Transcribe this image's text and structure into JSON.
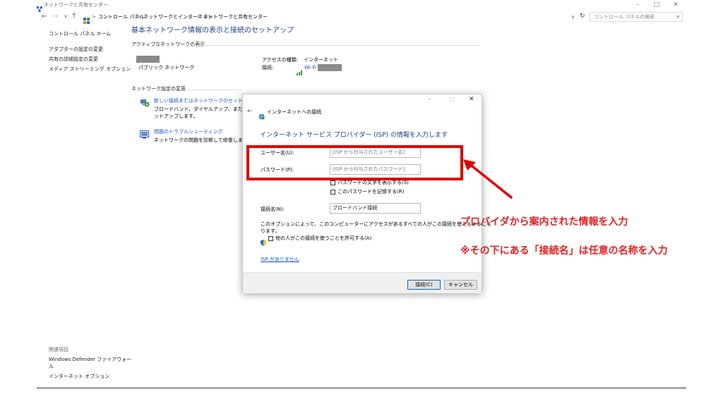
{
  "window": {
    "title": "ネットワークと共有センター",
    "controls": [
      "–",
      "□",
      "✕"
    ]
  },
  "address": {
    "breadcrumb": [
      "コントロール パネル",
      "ネットワークとインターネット",
      "ネットワークと共有センター"
    ],
    "separator": ">",
    "search_placeholder": "コントロール パネルの検索"
  },
  "sidebar": {
    "home": "コントロール パネル ホーム",
    "items": [
      "アダプターの設定の変更",
      "共有の詳細設定の変更",
      "メディア ストリーミング オプション"
    ],
    "related_heading": "関連項目",
    "related": [
      "Windows Defender ファイアウォー",
      "ル",
      "インターネット オプション"
    ]
  },
  "main": {
    "title": "基本ネットワーク情報の表示と接続のセットアップ",
    "active_heading": "アクティブなネットワークの表示",
    "network_type": "パブリック ネットワーク",
    "access_label": "アクセスの種類:",
    "access_value": "インターネット",
    "connection_label": "接続:",
    "connection_value": "Wi-Fi",
    "change_heading": "ネットワーク設定の変更",
    "tasks": [
      {
        "link": "新しい接続またはネットワークのセットアップ",
        "desc1": "ブロードバンド、ダイヤルアップ、または VPN 接",
        "desc2": "ットアップします。"
      },
      {
        "link": "問題のトラブルシューティング",
        "desc1": "ネットワークの問題を診断して修復します。また",
        "desc2": ""
      }
    ]
  },
  "dialog": {
    "nav_title": "インターネットへの接続",
    "heading": "インターネット サービス プロバイダー (ISP) の情報を入力します",
    "username_label": "ユーザー名(U):",
    "username_placeholder": "[ISP から付与されたユーザー名]",
    "password_label": "パスワード(P):",
    "password_placeholder": "[ISP から付与されたパスワード]",
    "show_password": "パスワードの文字を表示する(S)",
    "remember_password": "このパスワードを記憶する(R)",
    "conn_name_label": "接続名(N):",
    "conn_name_value": "ブロードバンド接続",
    "option_text1": "このオプションによって、このコンピューターにアクセスがあるすべての人がこの接続を使えるようにな",
    "option_text2": "ります。",
    "allow_others": "他の人がこの接続を使うことを許可する(A)",
    "no_isp_link": "ISP がありません",
    "connect_button": "接続(C)",
    "cancel_button": "キャンセル"
  },
  "annotation": {
    "line1": "プロバイダから案内された情報を入力",
    "line2": "※その下にある「接続名」は任意の名称を入力",
    "color": "#e00000"
  }
}
